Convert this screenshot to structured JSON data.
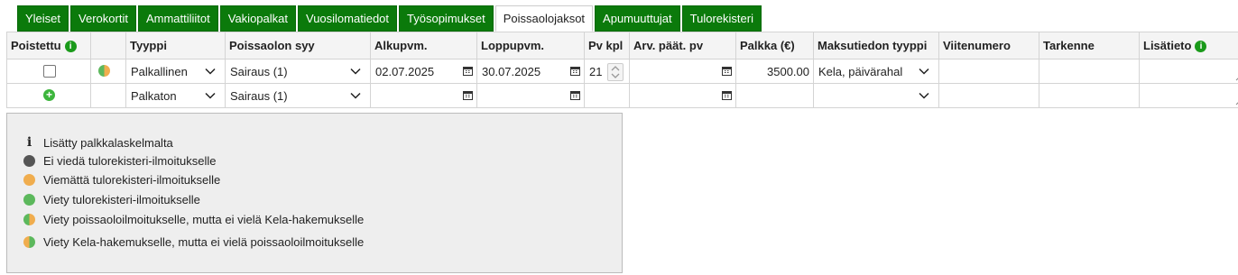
{
  "tabs": [
    {
      "label": "Yleiset",
      "active": false
    },
    {
      "label": "Verokortit",
      "active": false
    },
    {
      "label": "Ammattiliitot",
      "active": false
    },
    {
      "label": "Vakiopalkat",
      "active": false
    },
    {
      "label": "Vuosilomatiedot",
      "active": false
    },
    {
      "label": "Työsopimukset",
      "active": false
    },
    {
      "label": "Poissaolojaksot",
      "active": true
    },
    {
      "label": "Apumuuttujat",
      "active": false
    },
    {
      "label": "Tulorekisteri",
      "active": false
    }
  ],
  "columns": {
    "poistettu": "Poistettu",
    "status": "",
    "tyyppi": "Tyyppi",
    "syy": "Poissaolon syy",
    "alkupvm": "Alkupvm.",
    "loppupvm": "Loppupvm.",
    "pvkpl": "Pv kpl",
    "arv": "Arv. päät. pv",
    "palkka": "Palkka (€)",
    "maksutyyppi": "Maksutiedon tyyppi",
    "viite": "Viitenumero",
    "tarkenne": "Tarkenne",
    "lisatieto": "Lisätieto"
  },
  "rows": [
    {
      "tyyppi": "Palkallinen",
      "syy": "Sairaus (1)",
      "alkupvm": "02.07.2025",
      "loppupvm": "30.07.2025",
      "pvkpl": "21",
      "arv": "",
      "palkka": "3500.00",
      "maksutyyppi": "Kela, päivärahal",
      "viite": "",
      "tarkenne": "",
      "lisatieto": ""
    },
    {
      "tyyppi": "Palkaton",
      "syy": "Sairaus (1)",
      "alkupvm": "",
      "loppupvm": "",
      "pvkpl": "",
      "arv": "",
      "palkka": "",
      "maksutyyppi": "",
      "viite": "",
      "tarkenne": "",
      "lisatieto": ""
    }
  ],
  "legend": {
    "info": "Lisätty palkkalaskelmalta",
    "gray": "Ei viedä tulorekisteri-ilmoitukselle",
    "orange": "Viemättä tulorekisteri-ilmoitukselle",
    "green": "Viety tulorekisteri-ilmoitukselle",
    "half1": "Viety poissaoloilmoitukselle, mutta ei vielä Kela-hakemukselle",
    "half2": "Viety Kela-hakemukselle, mutta ei vielä poissaoloilmoitukselle"
  },
  "colors": {
    "tab_green": "#0b7a0b",
    "status_green": "#5cb85c",
    "status_orange": "#f0ad4e",
    "status_gray": "#555555"
  },
  "icons": {
    "info": "info-icon",
    "add": "plus-circle-icon",
    "calendar": "calendar-icon",
    "dropdown": "chevron-down-icon",
    "spinner": "spinner-icon",
    "resize": "resize-handle-icon"
  }
}
